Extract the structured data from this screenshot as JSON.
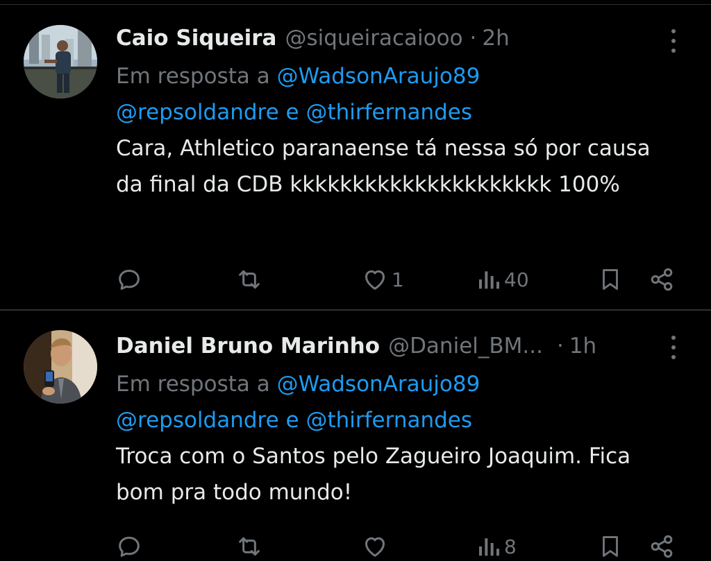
{
  "tweets": [
    {
      "name": "Caio Siqueira",
      "handle": "@siqueiracaiooo",
      "separator": "·",
      "time": "2h",
      "reply_prefix": "Em resposta a",
      "reply_to_1": "@WadsonAraujo89",
      "reply_to_2": "@repsoldandre",
      "reply_conjunction": "e",
      "reply_to_3": "@thirfernandes",
      "text": "Cara, Athletico paranaense tá nessa só por causa da final da CDB kkkkkkkkkkkkkkkkkkkkk 100%",
      "replies": "",
      "retweets": "",
      "likes": "1",
      "views": "40"
    },
    {
      "name": "Daniel Bruno Marinho",
      "handle": "@Daniel_BM...",
      "separator": "·",
      "time": "1h",
      "reply_prefix": "Em resposta a",
      "reply_to_1": "@WadsonAraujo89",
      "reply_to_2": "@repsoldandre",
      "reply_conjunction": "e",
      "reply_to_3": "@thirfernandes",
      "text": "Troca com o Santos pelo Zagueiro Joaquim. Fica bom pra todo mundo!",
      "replies": "",
      "retweets": "",
      "likes": "",
      "views": "8"
    }
  ],
  "icons": {
    "reply": "reply-icon",
    "retweet": "retweet-icon",
    "like": "heart-icon",
    "views": "views-icon",
    "bookmark": "bookmark-icon",
    "share": "share-icon",
    "more": "more-options-icon"
  },
  "colors": {
    "background": "#000000",
    "text": "#e7e9ea",
    "secondary": "#71767b",
    "link": "#1d9bf0",
    "divider": "#2f3336"
  }
}
